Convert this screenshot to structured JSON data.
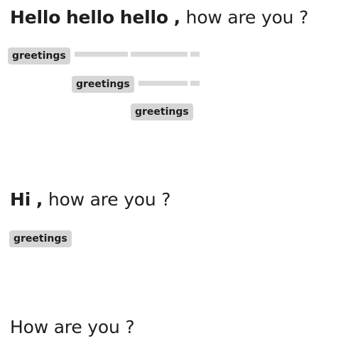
{
  "sentences": [
    {
      "bold_words": [
        "Hello",
        "hello",
        "hello",
        ","
      ],
      "rest": "how are you ?"
    },
    {
      "bold_words": [
        "Hi",
        ","
      ],
      "rest": "how are you ?"
    },
    {
      "bold_words": [],
      "rest": "How are you ?"
    }
  ],
  "tags": {
    "group1": [
      "greetings",
      "greetings",
      "greetings"
    ],
    "group2": [
      "greetings"
    ]
  }
}
